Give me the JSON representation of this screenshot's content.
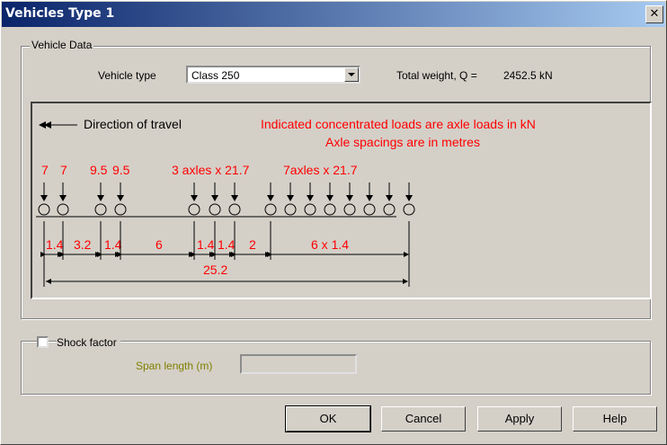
{
  "window": {
    "title": "Vehicles Type 1",
    "close_label": "✕"
  },
  "vehicle_data": {
    "legend": "Vehicle Data",
    "vehicle_type_label": "Vehicle type",
    "vehicle_type_value": "Class 250",
    "total_weight_label": "Total weight, Q =",
    "total_weight_value": "2452.5 kN"
  },
  "diagram": {
    "direction_label": "Direction of travel",
    "note_line1": "Indicated concentrated loads are axle loads in kN",
    "note_line2": "Axle spacings are in metres",
    "load_labels": [
      "7",
      "7",
      "9.5",
      "9.5",
      "3 axles x 21.7",
      "7axles x 21.7"
    ],
    "spacing_labels": [
      "1.4",
      "3.2",
      "1.4",
      "6",
      "1.4",
      "1.4",
      "2",
      "6 x 1.4"
    ],
    "total_length_label": "25.2",
    "text_color": "#ff0000"
  },
  "shock": {
    "checkbox_label": "Shock factor",
    "checked": false,
    "span_label": "Span length (m)",
    "span_value": ""
  },
  "buttons": {
    "ok": "OK",
    "cancel": "Cancel",
    "apply": "Apply",
    "help": "Help"
  }
}
